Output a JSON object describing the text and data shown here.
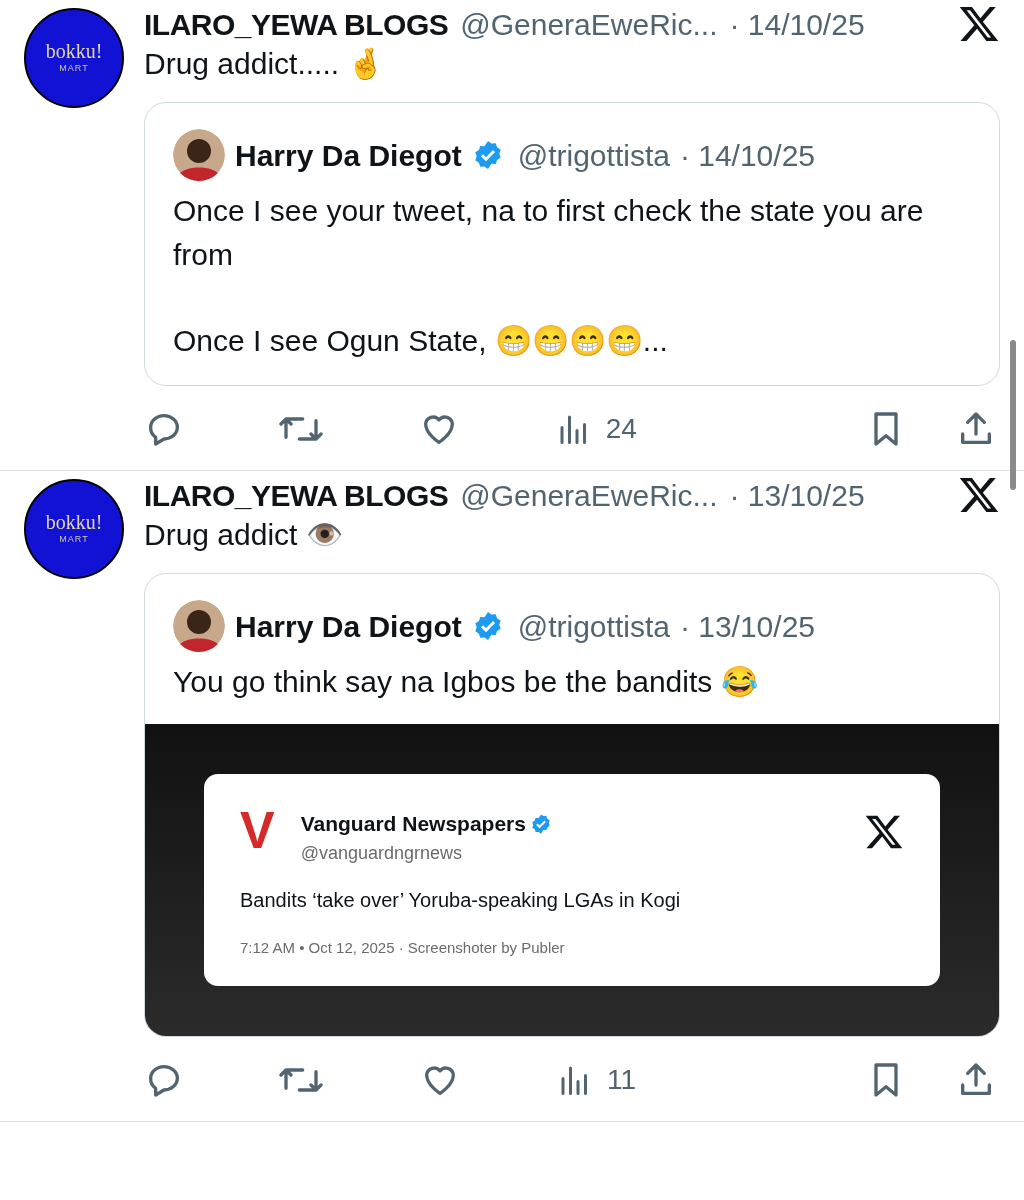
{
  "tweets": [
    {
      "avatar": {
        "brand": "bokku!",
        "sub": "MART"
      },
      "name": "ILARO_YEWA BLOGS",
      "handle": "@GeneraEweRic...",
      "date": "· 14/10/25",
      "text": "Drug addict..... 🤞",
      "quote": {
        "name": "Harry Da Diegot",
        "verified": true,
        "handle": "@trigottista",
        "date": "· 14/10/25",
        "paragraphs": [
          "Once I see your tweet, na to first check the state you are from",
          "Once I see Ogun State, 😁😁😁😁..."
        ]
      },
      "views": "24"
    },
    {
      "avatar": {
        "brand": "bokku!",
        "sub": "MART"
      },
      "name": "ILARO_YEWA BLOGS",
      "handle": "@GeneraEweRic...",
      "date": "· 13/10/25",
      "text": "Drug addict 👁️",
      "quote": {
        "name": "Harry Da Diegot",
        "verified": true,
        "handle": "@trigottista",
        "date": "· 13/10/25",
        "paragraphs": [
          "You go think say na Igbos be the bandits 😂"
        ],
        "media": {
          "kind": "tweet_screenshot",
          "logo": "V",
          "name": "Vanguard Newspapers",
          "verified": true,
          "handle": "@vanguardngrnews",
          "text": "Bandits ‘take over’ Yoruba-speaking LGAs in Kogi",
          "meta": "7:12 AM • Oct 12, 2025 · Screenshoter by Publer"
        }
      },
      "views": "11"
    }
  ]
}
